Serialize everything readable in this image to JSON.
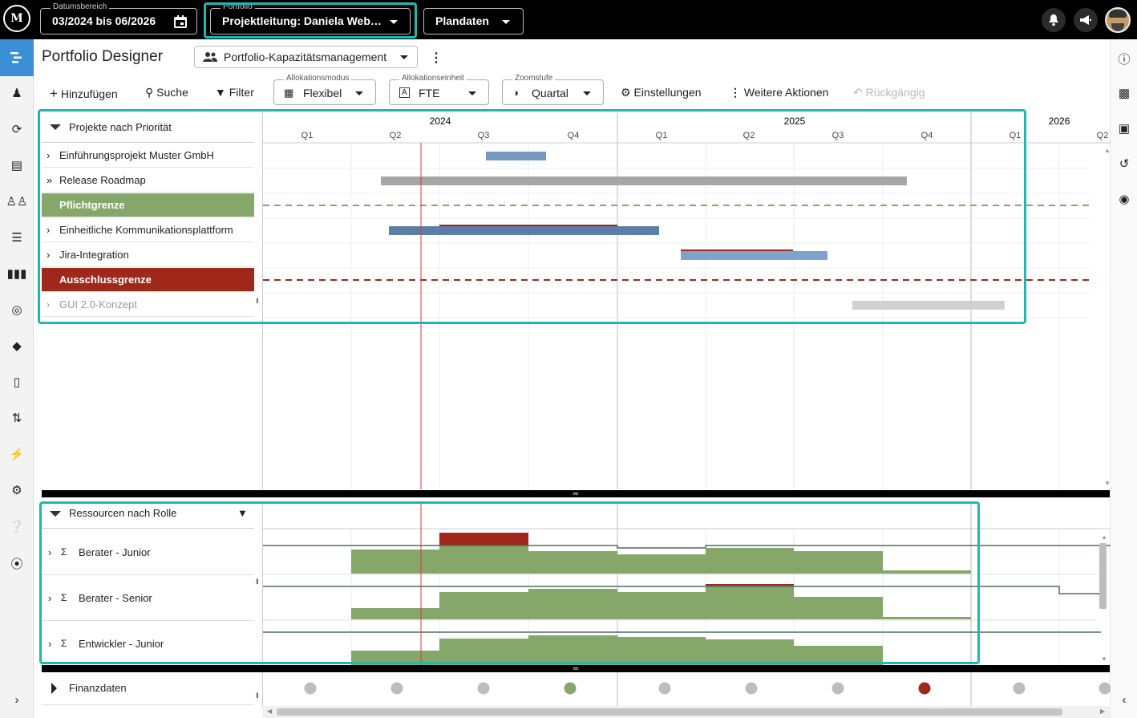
{
  "topbar": {
    "logo": "M",
    "date_range": {
      "legend": "Datumsbereich",
      "value": "03/2024 bis 06/2026",
      "icon": "calendar-icon"
    },
    "portfolio": {
      "legend": "Portfolio",
      "value": "Projektleitung: Daniela Web…"
    },
    "data_type": {
      "value": "Plandaten"
    },
    "icons": [
      "bell-icon",
      "megaphone-icon",
      "user-avatar"
    ]
  },
  "page": {
    "title": "Portfolio Designer",
    "view_select": "Portfolio-Kapazitätsmanagement"
  },
  "toolbar": {
    "add": "Hinzufügen",
    "search": "Suche",
    "filter": "Filter",
    "allocation_mode": {
      "legend": "Allokationsmodus",
      "value": "Flexibel"
    },
    "allocation_unit": {
      "legend": "Allokationseinheit",
      "value": "FTE"
    },
    "zoom": {
      "legend": "Zoomstufe",
      "value": "Quartal"
    },
    "settings": "Einstellungen",
    "more": "Weitere Aktionen",
    "undo": "Rückgängig"
  },
  "timeline": {
    "years": [
      "2024",
      "2025",
      "2026"
    ],
    "quarters": [
      "Q1",
      "Q2",
      "Q3",
      "Q4",
      "Q1",
      "Q2",
      "Q3",
      "Q4",
      "Q1",
      "Q2"
    ]
  },
  "projects": {
    "header": "Projekte nach Priorität",
    "rows": [
      {
        "label": "Einführungsprojekt Muster GmbH",
        "type": "project"
      },
      {
        "label": "Release Roadmap",
        "type": "roadmap"
      },
      {
        "label": "Pflichtgrenze",
        "type": "boundary",
        "color": "#85a86a"
      },
      {
        "label": "Einheitliche Kommunikationsplattform",
        "type": "project"
      },
      {
        "label": "Jira-Integration",
        "type": "project"
      },
      {
        "label": "Ausschlussgrenze",
        "type": "boundary",
        "color": "#a0281b"
      },
      {
        "label": "GUI 2.0-Konzept",
        "type": "excluded"
      }
    ]
  },
  "resources": {
    "header": "Ressourcen nach Rolle",
    "rows": [
      "Berater - Junior",
      "Berater - Senior",
      "Entwickler - Junior"
    ]
  },
  "finance": {
    "label": "Finanzdaten",
    "status_colors": [
      "#bdbdbd",
      "#bdbdbd",
      "#bdbdbd",
      "#85a86a",
      "#bdbdbd",
      "#bdbdbd",
      "#bdbdbd",
      "#a0281b",
      "#bdbdbd",
      "#bdbdbd"
    ]
  },
  "colors": {
    "accent": "#1fb8b0",
    "nav_active": "#3a8fd6",
    "capacity_green": "#85a86a",
    "overload_red": "#a0281b"
  }
}
